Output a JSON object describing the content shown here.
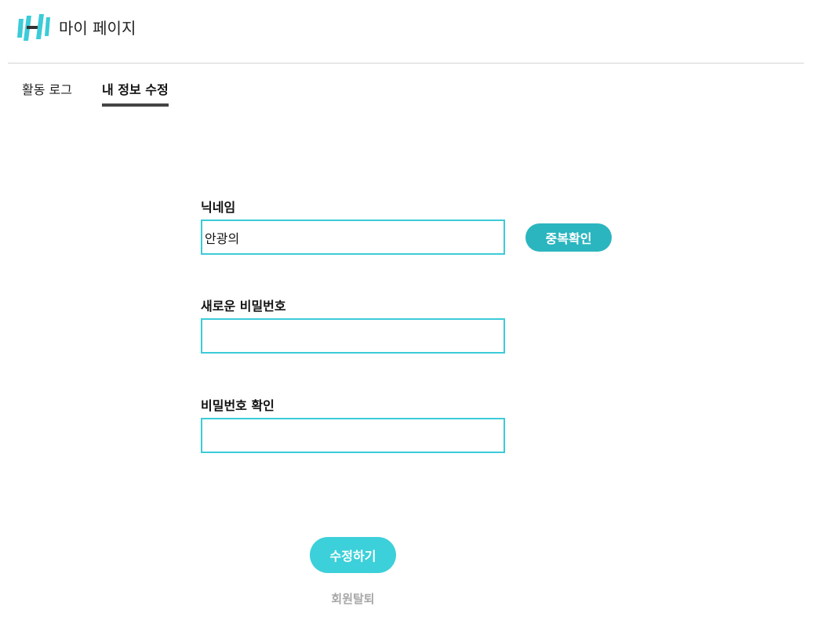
{
  "header": {
    "title": "마이 페이지",
    "logo_icon": "dumbbell-h-logo",
    "brand_color": "#3ccbd8"
  },
  "tabs": [
    {
      "label": "활동 로그",
      "active": false
    },
    {
      "label": "내 정보 수정",
      "active": true
    }
  ],
  "form": {
    "nickname": {
      "label": "닉네임",
      "value": "안광의",
      "check_button_label": "중복확인"
    },
    "new_password": {
      "label": "새로운 비밀번호",
      "value": ""
    },
    "confirm_password": {
      "label": "비밀번호 확인",
      "value": ""
    },
    "submit_label": "수정하기",
    "withdraw_label": "회원탈퇴"
  },
  "colors": {
    "accent": "#3ccbd8",
    "button_dark": "#2bb5bf",
    "muted_text": "#a8a8a8"
  }
}
